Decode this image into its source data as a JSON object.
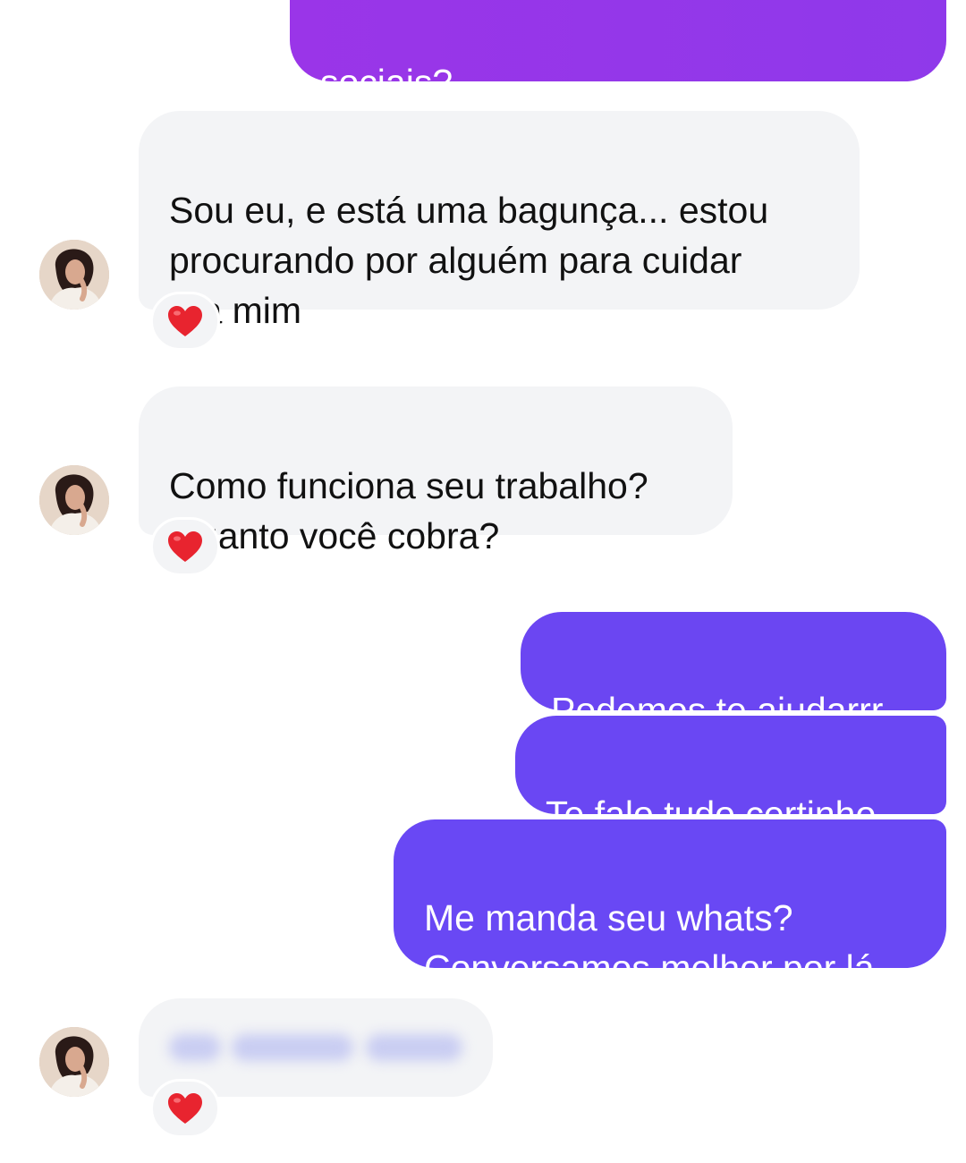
{
  "colors": {
    "outgoing_top": "#9a35e8",
    "outgoing_lower": "#6b45f2",
    "incoming_bg": "#f3f4f6",
    "reaction_heart": "#e8242f"
  },
  "messages": [
    {
      "sender": "me",
      "text": "sociais?"
    },
    {
      "sender": "contact",
      "text": "Sou eu, e está uma bagunça... estou\nprocurando por alguém para cuidar\npra mim",
      "reaction": "heart-icon"
    },
    {
      "sender": "contact",
      "text": "Como funciona seu trabalho?\nQuanto você cobra?",
      "reaction": "heart-icon"
    },
    {
      "sender": "me",
      "text": "Podemos te ajudarrr"
    },
    {
      "sender": "me",
      "text": "Te falo tudo certinho"
    },
    {
      "sender": "me",
      "text": "Me manda seu whats?\nConversamos melhor por lá"
    },
    {
      "sender": "contact",
      "text": "",
      "blurred": true,
      "reaction": "heart-icon"
    }
  ]
}
